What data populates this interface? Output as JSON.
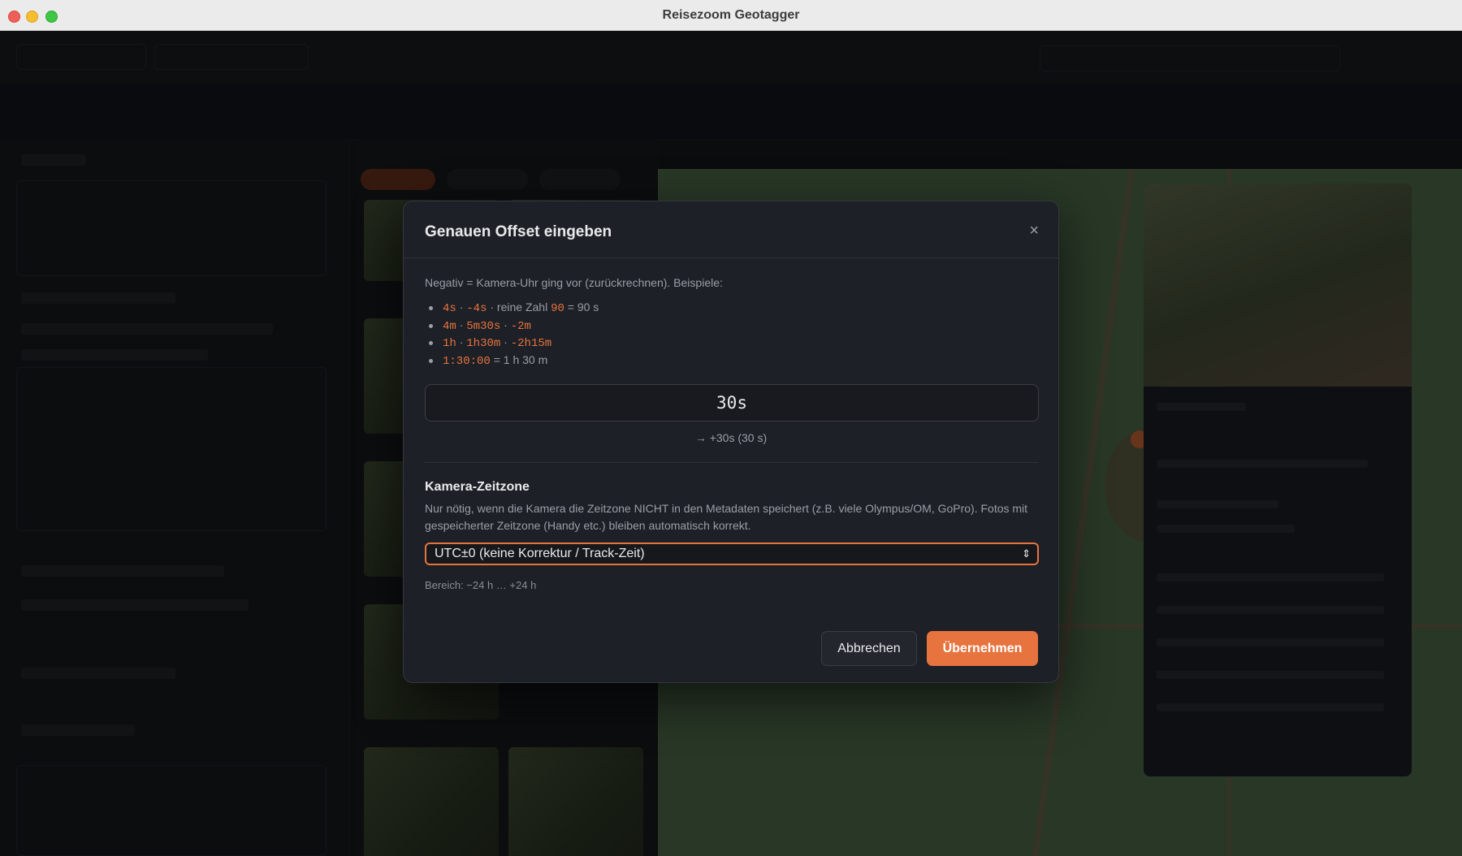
{
  "window": {
    "title": "Reisezoom Geotagger"
  },
  "modal": {
    "title": "Genauen Offset eingeben",
    "close_glyph": "×",
    "intro": "Negativ = Kamera-Uhr ging vor (zurückrechnen). Beispiele:",
    "examples": [
      {
        "parts": [
          {
            "text": "4s",
            "code": true
          },
          {
            "text": " · ",
            "code": false
          },
          {
            "text": "-4s",
            "code": true
          },
          {
            "text": " · reine Zahl ",
            "code": false
          },
          {
            "text": "90",
            "code": true
          },
          {
            "text": " = 90 s",
            "code": false
          }
        ]
      },
      {
        "parts": [
          {
            "text": "4m",
            "code": true
          },
          {
            "text": " · ",
            "code": false
          },
          {
            "text": "5m30s",
            "code": true
          },
          {
            "text": " · ",
            "code": false
          },
          {
            "text": "-2m",
            "code": true
          }
        ]
      },
      {
        "parts": [
          {
            "text": "1h",
            "code": true
          },
          {
            "text": " · ",
            "code": false
          },
          {
            "text": "1h30m",
            "code": true
          },
          {
            "text": " · ",
            "code": false
          },
          {
            "text": "-2h15m",
            "code": true
          }
        ]
      },
      {
        "parts": [
          {
            "text": "1:30:00",
            "code": true
          },
          {
            "text": " = 1 h 30 m",
            "code": false
          }
        ]
      }
    ],
    "offset_input": {
      "value": "30s"
    },
    "preview": "→ +30s (30 s)",
    "timezone": {
      "heading": "Kamera-Zeitzone",
      "description": "Nur nötig, wenn die Kamera die Zeitzone NICHT in den Metadaten speichert (z.B. viele Olympus/OM, GoPro). Fotos mit gespeicherter Zeitzone (Handy etc.) bleiben automatisch korrekt.",
      "selected": "UTC±0 (keine Korrektur / Track-Zeit)",
      "chevron_glyph": "⇕"
    },
    "range": "Bereich: −24 h … +24 h",
    "buttons": {
      "cancel": "Abbrechen",
      "apply": "Übernehmen"
    }
  },
  "colors": {
    "accent": "#e7733f",
    "modal_bg": "#1d2026",
    "text": "#e9eaec",
    "muted": "#9a9ea6"
  }
}
